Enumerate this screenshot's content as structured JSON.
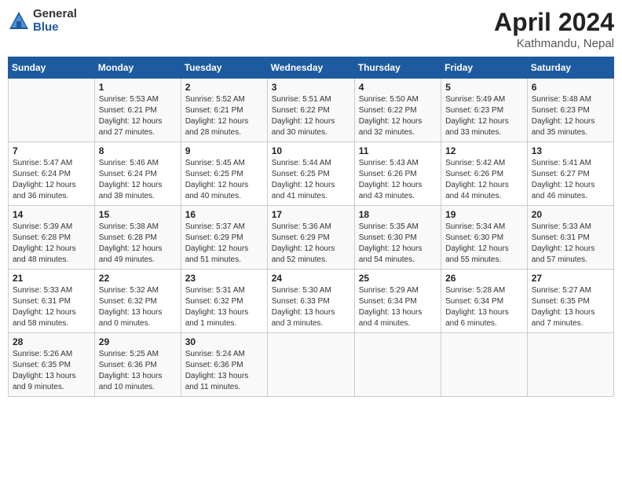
{
  "logo": {
    "general": "General",
    "blue": "Blue"
  },
  "title": {
    "month": "April 2024",
    "location": "Kathmandu, Nepal"
  },
  "headers": [
    "Sunday",
    "Monday",
    "Tuesday",
    "Wednesday",
    "Thursday",
    "Friday",
    "Saturday"
  ],
  "weeks": [
    [
      {
        "num": "",
        "info": ""
      },
      {
        "num": "1",
        "info": "Sunrise: 5:53 AM\nSunset: 6:21 PM\nDaylight: 12 hours\nand 27 minutes."
      },
      {
        "num": "2",
        "info": "Sunrise: 5:52 AM\nSunset: 6:21 PM\nDaylight: 12 hours\nand 28 minutes."
      },
      {
        "num": "3",
        "info": "Sunrise: 5:51 AM\nSunset: 6:22 PM\nDaylight: 12 hours\nand 30 minutes."
      },
      {
        "num": "4",
        "info": "Sunrise: 5:50 AM\nSunset: 6:22 PM\nDaylight: 12 hours\nand 32 minutes."
      },
      {
        "num": "5",
        "info": "Sunrise: 5:49 AM\nSunset: 6:23 PM\nDaylight: 12 hours\nand 33 minutes."
      },
      {
        "num": "6",
        "info": "Sunrise: 5:48 AM\nSunset: 6:23 PM\nDaylight: 12 hours\nand 35 minutes."
      }
    ],
    [
      {
        "num": "7",
        "info": "Sunrise: 5:47 AM\nSunset: 6:24 PM\nDaylight: 12 hours\nand 36 minutes."
      },
      {
        "num": "8",
        "info": "Sunrise: 5:46 AM\nSunset: 6:24 PM\nDaylight: 12 hours\nand 38 minutes."
      },
      {
        "num": "9",
        "info": "Sunrise: 5:45 AM\nSunset: 6:25 PM\nDaylight: 12 hours\nand 40 minutes."
      },
      {
        "num": "10",
        "info": "Sunrise: 5:44 AM\nSunset: 6:25 PM\nDaylight: 12 hours\nand 41 minutes."
      },
      {
        "num": "11",
        "info": "Sunrise: 5:43 AM\nSunset: 6:26 PM\nDaylight: 12 hours\nand 43 minutes."
      },
      {
        "num": "12",
        "info": "Sunrise: 5:42 AM\nSunset: 6:26 PM\nDaylight: 12 hours\nand 44 minutes."
      },
      {
        "num": "13",
        "info": "Sunrise: 5:41 AM\nSunset: 6:27 PM\nDaylight: 12 hours\nand 46 minutes."
      }
    ],
    [
      {
        "num": "14",
        "info": "Sunrise: 5:39 AM\nSunset: 6:28 PM\nDaylight: 12 hours\nand 48 minutes."
      },
      {
        "num": "15",
        "info": "Sunrise: 5:38 AM\nSunset: 6:28 PM\nDaylight: 12 hours\nand 49 minutes."
      },
      {
        "num": "16",
        "info": "Sunrise: 5:37 AM\nSunset: 6:29 PM\nDaylight: 12 hours\nand 51 minutes."
      },
      {
        "num": "17",
        "info": "Sunrise: 5:36 AM\nSunset: 6:29 PM\nDaylight: 12 hours\nand 52 minutes."
      },
      {
        "num": "18",
        "info": "Sunrise: 5:35 AM\nSunset: 6:30 PM\nDaylight: 12 hours\nand 54 minutes."
      },
      {
        "num": "19",
        "info": "Sunrise: 5:34 AM\nSunset: 6:30 PM\nDaylight: 12 hours\nand 55 minutes."
      },
      {
        "num": "20",
        "info": "Sunrise: 5:33 AM\nSunset: 6:31 PM\nDaylight: 12 hours\nand 57 minutes."
      }
    ],
    [
      {
        "num": "21",
        "info": "Sunrise: 5:33 AM\nSunset: 6:31 PM\nDaylight: 12 hours\nand 58 minutes."
      },
      {
        "num": "22",
        "info": "Sunrise: 5:32 AM\nSunset: 6:32 PM\nDaylight: 13 hours\nand 0 minutes."
      },
      {
        "num": "23",
        "info": "Sunrise: 5:31 AM\nSunset: 6:32 PM\nDaylight: 13 hours\nand 1 minutes."
      },
      {
        "num": "24",
        "info": "Sunrise: 5:30 AM\nSunset: 6:33 PM\nDaylight: 13 hours\nand 3 minutes."
      },
      {
        "num": "25",
        "info": "Sunrise: 5:29 AM\nSunset: 6:34 PM\nDaylight: 13 hours\nand 4 minutes."
      },
      {
        "num": "26",
        "info": "Sunrise: 5:28 AM\nSunset: 6:34 PM\nDaylight: 13 hours\nand 6 minutes."
      },
      {
        "num": "27",
        "info": "Sunrise: 5:27 AM\nSunset: 6:35 PM\nDaylight: 13 hours\nand 7 minutes."
      }
    ],
    [
      {
        "num": "28",
        "info": "Sunrise: 5:26 AM\nSunset: 6:35 PM\nDaylight: 13 hours\nand 9 minutes."
      },
      {
        "num": "29",
        "info": "Sunrise: 5:25 AM\nSunset: 6:36 PM\nDaylight: 13 hours\nand 10 minutes."
      },
      {
        "num": "30",
        "info": "Sunrise: 5:24 AM\nSunset: 6:36 PM\nDaylight: 13 hours\nand 11 minutes."
      },
      {
        "num": "",
        "info": ""
      },
      {
        "num": "",
        "info": ""
      },
      {
        "num": "",
        "info": ""
      },
      {
        "num": "",
        "info": ""
      }
    ]
  ]
}
